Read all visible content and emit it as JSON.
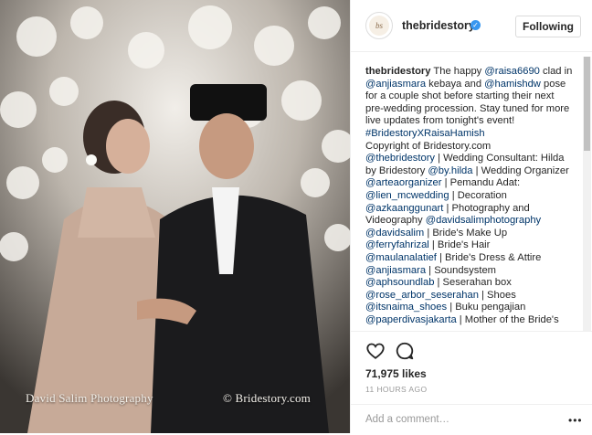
{
  "post": {
    "photo_watermark_left": "David Salim Photography",
    "photo_watermark_right": "© Bridestory.com"
  },
  "header": {
    "username": "thebridestory",
    "follow_label": "Following"
  },
  "caption": {
    "p1_handle": "thebridestory",
    "p1_a": " The happy ",
    "p1_m1": "@raisa6690",
    "p1_b": " clad in ",
    "p1_m2": "@anjiasmara",
    "p1_c": " kebaya and ",
    "p1_m3": "@hamishdw",
    "p1_d": " pose for a couple shot before starting their next pre-wedding procession. Stay tuned for more live updates from tonight's event! ",
    "p1_hashtag": "#BridestoryXRaisaHamish",
    "p2": "Copyright of Bridestory.com",
    "p3_m1": "@thebridestory",
    "p3_a": " | Wedding Consultant: Hilda by Bridestory ",
    "p3_m2": "@by.hilda",
    "p3_b": " | Wedding Organizer ",
    "p3_m3": "@arteaorganizer",
    "p3_c": " | Pemandu Adat: ",
    "p3_m4": "@lien_mcwedding",
    "p3_d": " | Decoration ",
    "p3_m5": "@azkaanggunart",
    "p3_e": " | Photography and Videography ",
    "p3_m6": "@davidsalimphotography",
    "p4_m1": "@davidsalim",
    "p4_a": " | Bride's Make Up",
    "p5_m1": "@ferryfahrizal",
    "p5_a": " | Bride's Hair",
    "p6_m1": "@maulanalatief",
    "p6_a": " | Bride's Dress & Attire",
    "p7_m1": "@anjiasmara",
    "p7_a": " | Soundsystem",
    "p8_m1": "@aphsoundlab",
    "p8_a": " | Seserahan box",
    "p9_m1": "@rose_arbor_seserahan",
    "p9_a": " | Shoes",
    "p10_m1": "@itsnaima_shoes",
    "p10_a": " | Buku pengajian",
    "p11_m1": "@paperdivasjakarta",
    "p11_a": " | Mother of the Bride's"
  },
  "actions": {
    "likes": "71,975 likes",
    "time": "11 HOURS AGO",
    "comment_placeholder": "Add a comment…",
    "more_label": "•••"
  },
  "icons": {
    "heart": "heart-icon",
    "comment": "comment-icon",
    "verified": "verified-badge-icon",
    "more": "more-options-icon"
  },
  "colors": {
    "link": "#003569",
    "verified": "#3897f0",
    "muted": "#999999",
    "text": "#262626"
  }
}
